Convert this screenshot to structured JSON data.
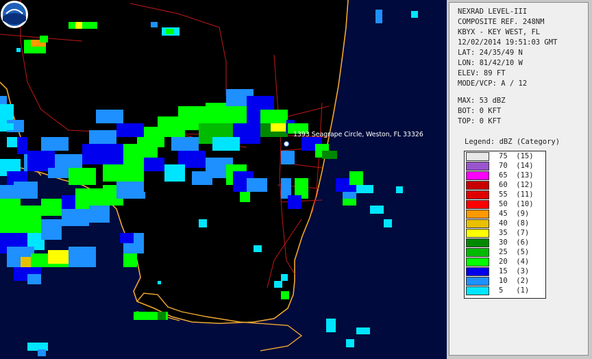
{
  "station": {
    "product": "NEXRAD LEVEL-III",
    "type": "COMPOSITE REF. 248NM",
    "site": "KBYX - KEY WEST, FL",
    "datetime": "12/02/2014 19:51:03 GMT",
    "lat": "LAT: 24/35/49 N",
    "lon": "LON: 81/42/10 W",
    "elev": "ELEV: 89 FT",
    "mode": "MODE/VCP: A / 12",
    "max": "MAX: 53 dBZ",
    "bot": "BOT: 0 KFT",
    "top": "TOP: 0 KFT"
  },
  "marker": {
    "label": "1393 Seagrape Circle, Weston, FL 33326"
  },
  "legend": {
    "title": "Legend: dBZ (Category)",
    "items": [
      {
        "label": "75  (15)",
        "color": "#e8e8e8"
      },
      {
        "label": "70  (14)",
        "color": "#9955cc"
      },
      {
        "label": "65  (13)",
        "color": "#ff00ff"
      },
      {
        "label": "60  (12)",
        "color": "#c80000"
      },
      {
        "label": "55  (11)",
        "color": "#e00000"
      },
      {
        "label": "50  (10)",
        "color": "#ff0000"
      },
      {
        "label": "45  (9)",
        "color": "#ff9900"
      },
      {
        "label": "40  (8)",
        "color": "#e8c000"
      },
      {
        "label": "35  (7)",
        "color": "#ffff00"
      },
      {
        "label": "30  (6)",
        "color": "#008800"
      },
      {
        "label": "25  (5)",
        "color": "#00bb00"
      },
      {
        "label": "20  (4)",
        "color": "#00ff00"
      },
      {
        "label": "15  (3)",
        "color": "#0000ee"
      },
      {
        "label": "10  (2)",
        "color": "#1e90ff"
      },
      {
        "label": "5   (1)",
        "color": "#00e5ff"
      }
    ]
  },
  "logo": {
    "text": "NOAA",
    "name": "noaa-logo"
  },
  "colors": {
    "ocean": "#000a3c",
    "land": "#000000",
    "coast": "#f0a830",
    "roads": "#c01818"
  }
}
